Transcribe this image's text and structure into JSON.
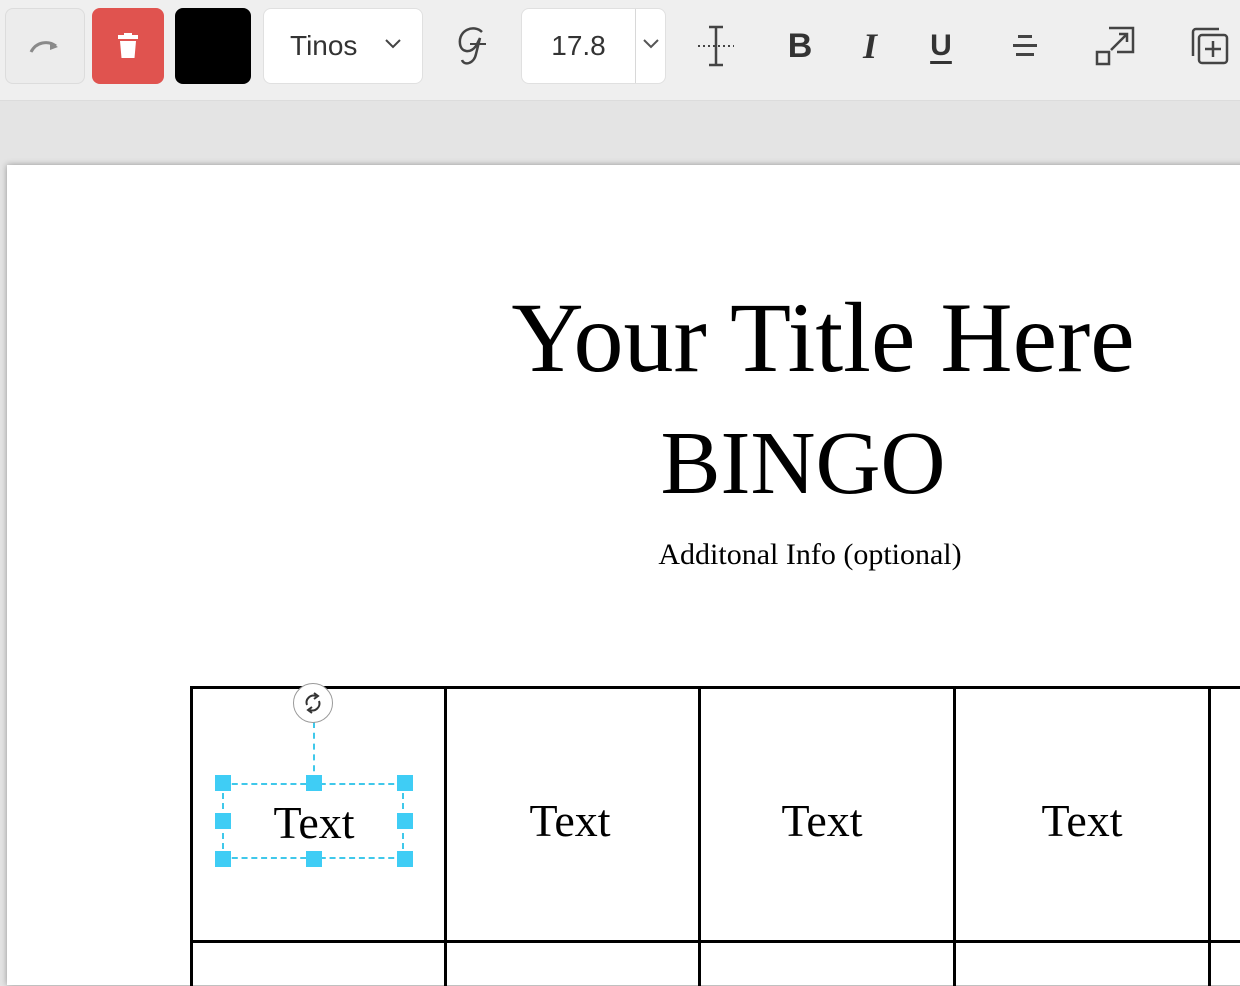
{
  "toolbar": {
    "font_family": "Tinos",
    "font_size": "17.8",
    "text_color": "#000000",
    "bold_label": "B",
    "italic_label": "I",
    "underline_label": "U",
    "icons": [
      "redo-icon",
      "trash-icon",
      "chevron-down-icon",
      "script-font-icon",
      "text-spacing-icon",
      "align-center-icon",
      "resize-icon",
      "duplicate-icon"
    ]
  },
  "canvas": {
    "title": "Your Title Here",
    "subtitle": "BINGO",
    "info": "Additonal Info (optional)",
    "cells": [
      "Text",
      "Text",
      "Text",
      "Text"
    ]
  },
  "colors": {
    "delete_button": "#e0534f",
    "selection": "#3fc8ea"
  }
}
